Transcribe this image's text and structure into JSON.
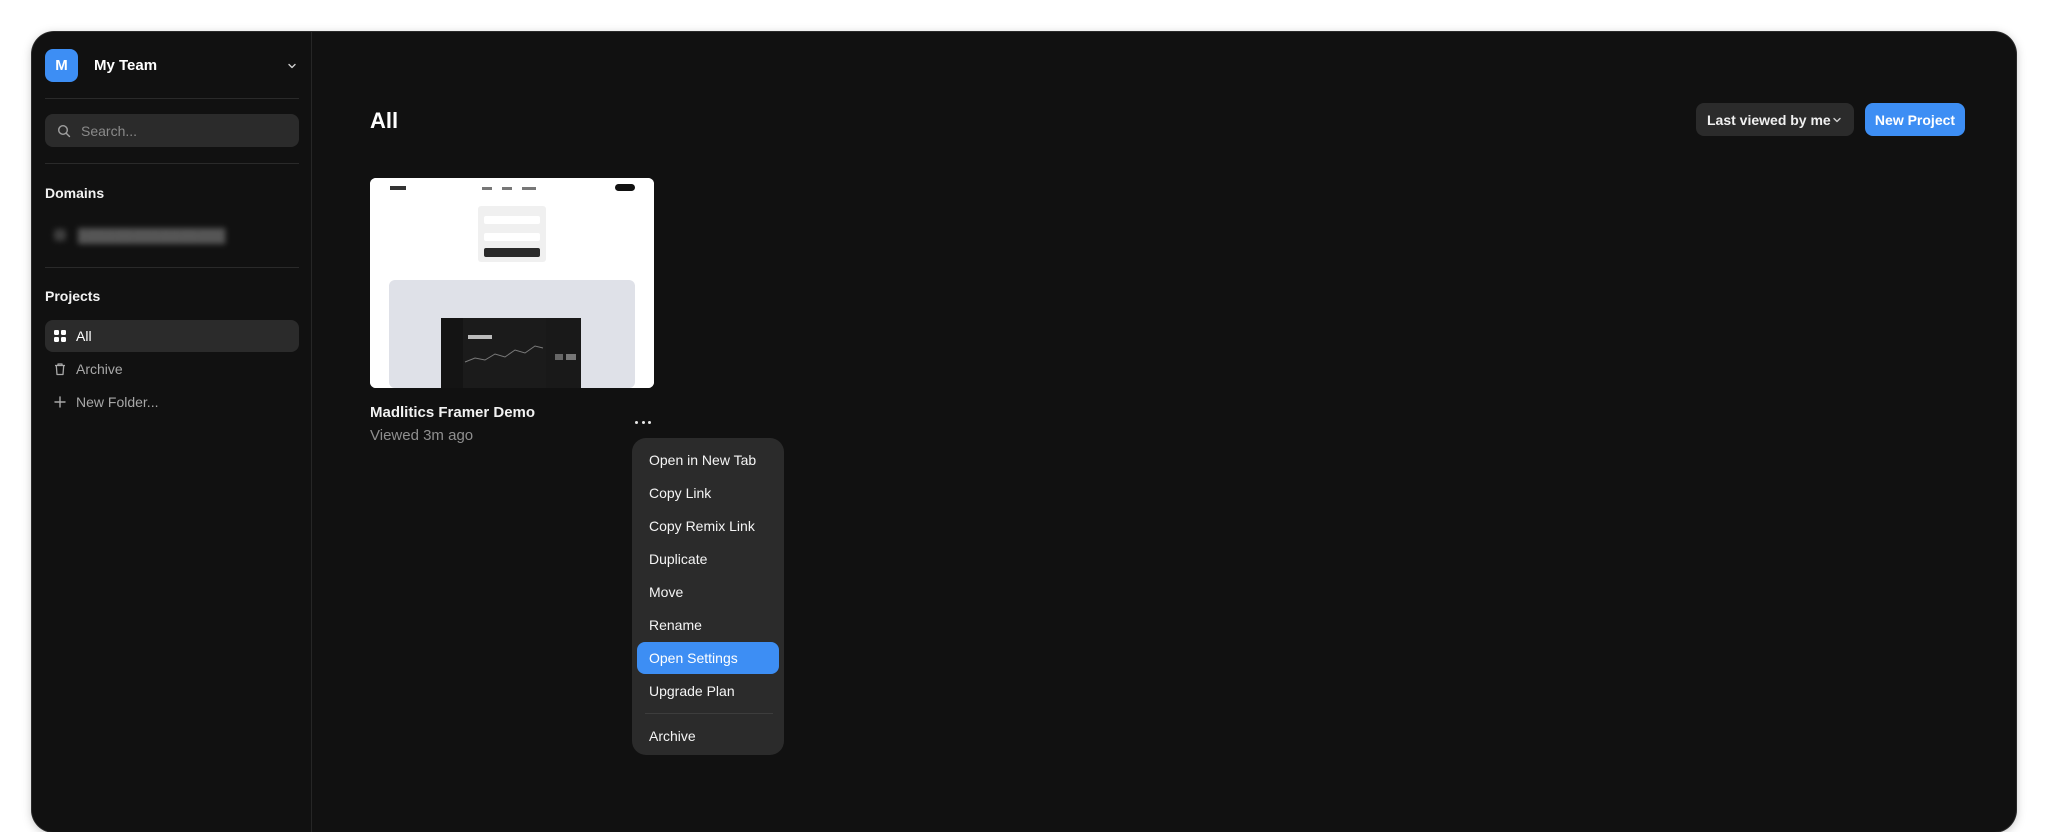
{
  "team": {
    "avatar_letter": "M",
    "name": "My Team"
  },
  "search": {
    "placeholder": "Search..."
  },
  "sidebar": {
    "domains_label": "Domains",
    "projects_label": "Projects",
    "items": [
      {
        "label": "All",
        "icon": "grid-icon",
        "active": true
      },
      {
        "label": "Archive",
        "icon": "trash-icon",
        "active": false
      },
      {
        "label": "New Folder...",
        "icon": "plus-icon",
        "active": false
      }
    ]
  },
  "main": {
    "title": "All",
    "sort_label": "Last viewed by me",
    "new_project_label": "New Project"
  },
  "project": {
    "name": "Madlitics Framer Demo",
    "viewed": "Viewed 3m ago"
  },
  "context_menu": {
    "items": [
      "Open in New Tab",
      "Copy Link",
      "Copy Remix Link",
      "Duplicate",
      "Move",
      "Rename",
      "Open Settings",
      "Upgrade Plan"
    ],
    "highlighted": "Open Settings",
    "archive_label": "Archive"
  },
  "colors": {
    "accent": "#3d8ef4",
    "background": "#111111",
    "surface": "#2b2b2b"
  }
}
